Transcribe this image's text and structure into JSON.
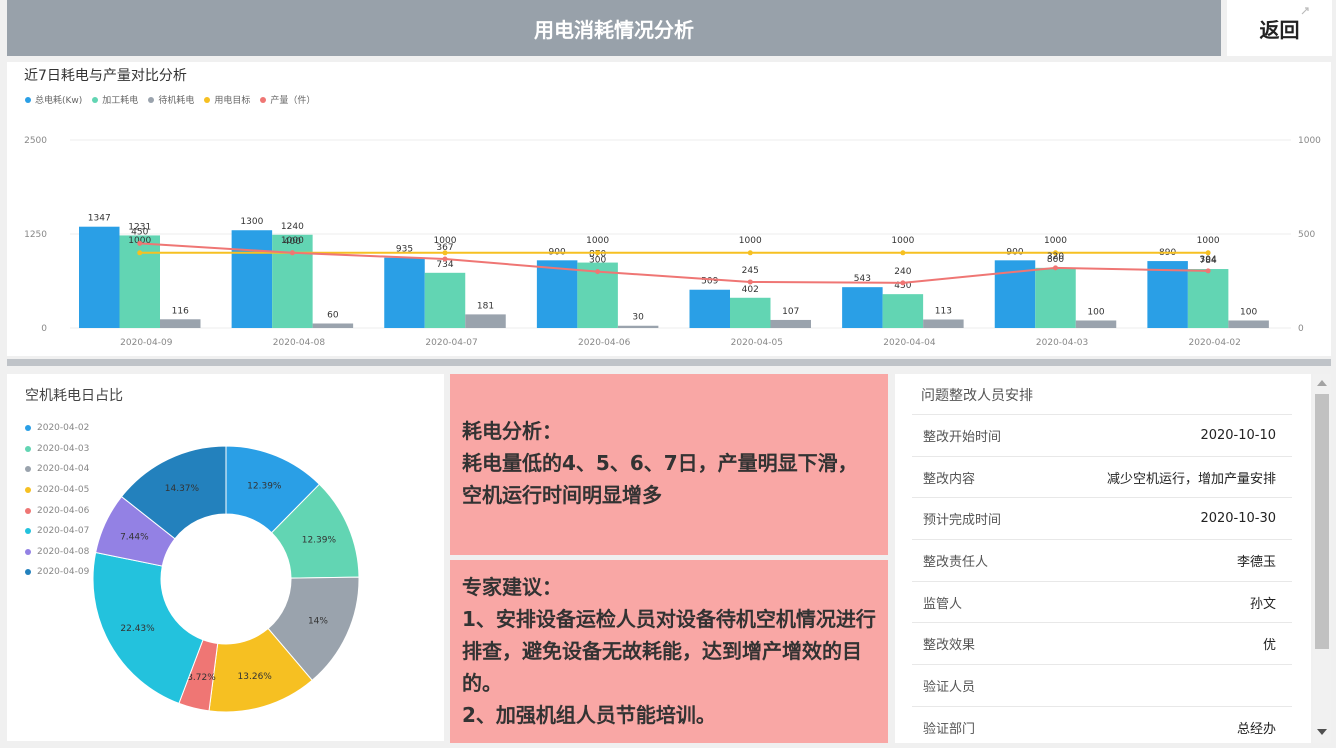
{
  "header": {
    "title": "用电消耗情况分析",
    "back_label": "返回"
  },
  "colors": {
    "total": "#2a9fe6",
    "process": "#62d5b3",
    "standby": "#9aa3ad",
    "target": "#f6c022",
    "output": "#ef7674"
  },
  "chart_data": [
    {
      "type": "bar",
      "title": "近7日耗电与产量对比分析",
      "categories": [
        "2020-04-09",
        "2020-04-08",
        "2020-04-07",
        "2020-04-06",
        "2020-04-05",
        "2020-04-04",
        "2020-04-03",
        "2020-04-02"
      ],
      "left_axis": {
        "ylim": [
          0,
          2500
        ],
        "ticks": [
          "0",
          "1250",
          "2500"
        ]
      },
      "right_axis": {
        "ylim": [
          0,
          1000
        ],
        "ticks": [
          "0",
          "500",
          "1000"
        ]
      },
      "legend": [
        "总电耗(Kw)",
        "加工耗电",
        "待机耗电",
        "用电目标",
        "产量（件）"
      ],
      "series": [
        {
          "name": "总电耗(Kw)",
          "kind": "bar",
          "axis": "left",
          "values": [
            1347,
            1300,
            935,
            900,
            509,
            543,
            900,
            890
          ]
        },
        {
          "name": "加工耗电",
          "kind": "bar",
          "axis": "left",
          "values": [
            1231,
            1240,
            734,
            870,
            402,
            450,
            800,
            784
          ]
        },
        {
          "name": "待机耗电",
          "kind": "bar",
          "axis": "left",
          "values": [
            116,
            60,
            181,
            30,
            107,
            113,
            100,
            100
          ]
        },
        {
          "name": "用电目标",
          "kind": "line",
          "axis": "left",
          "values": [
            1000,
            1000,
            1000,
            1000,
            1000,
            1000,
            1000,
            1000
          ]
        },
        {
          "name": "产量（件）",
          "kind": "line",
          "axis": "right",
          "values": [
            450,
            400,
            367,
            300,
            245,
            240,
            320,
            304
          ]
        }
      ]
    },
    {
      "type": "pie",
      "title": "空机耗电日占比",
      "labels": [
        "2020-04-02",
        "2020-04-03",
        "2020-04-04",
        "2020-04-05",
        "2020-04-06",
        "2020-04-07",
        "2020-04-08",
        "2020-04-09"
      ],
      "values": [
        12.39,
        12.39,
        14,
        13.26,
        3.72,
        22.43,
        7.44,
        14.37
      ],
      "value_labels": [
        "12.39%",
        "12.39%",
        "14%",
        "13.26%",
        "3.72%",
        "22.43%",
        "7.44%",
        "14.37%"
      ],
      "colors": [
        "#2a9fe6",
        "#62d5b3",
        "#9aa3ad",
        "#f6c022",
        "#ef7674",
        "#23c2dd",
        "#9381e4",
        "#2381bd"
      ]
    }
  ],
  "analysis": {
    "heading": "耗电分析：",
    "body": "耗电量低的4、5、6、7日，产量明显下滑，空机运行时间明显增多"
  },
  "advice": {
    "heading": "专家建议：",
    "items": [
      "1、安排设备运检人员对设备待机空机情况进行排查，避免设备无故耗能，达到增产增效的目的。",
      "2、加强机组人员节能培训。"
    ]
  },
  "table": {
    "title": "问题整改人员安排",
    "rows": [
      {
        "label": "整改开始时间",
        "value": "2020-10-10"
      },
      {
        "label": "整改内容",
        "value": "减少空机运行，增加产量安排"
      },
      {
        "label": "预计完成时间",
        "value": "2020-10-30"
      },
      {
        "label": "整改责任人",
        "value": "李德玉"
      },
      {
        "label": "监管人",
        "value": "孙文"
      },
      {
        "label": "整改效果",
        "value": "优"
      },
      {
        "label": "验证人员",
        "value": ""
      },
      {
        "label": "验证部门",
        "value": "总经办"
      }
    ]
  }
}
